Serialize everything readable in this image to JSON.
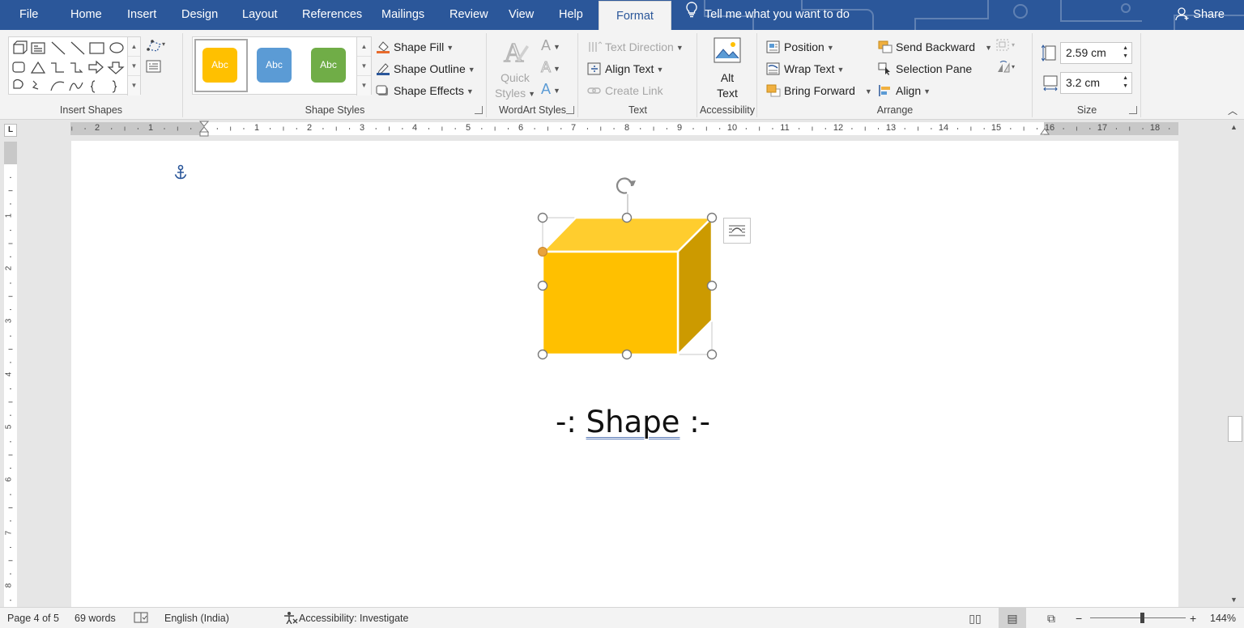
{
  "tabs": [
    "File",
    "Home",
    "Insert",
    "Design",
    "Layout",
    "References",
    "Mailings",
    "Review",
    "View",
    "Help"
  ],
  "active_tab": "Format",
  "tell_me": "Tell me what you want to do",
  "share": "Share",
  "ribbon": {
    "insert_shapes": {
      "label": "Insert Shapes"
    },
    "shape_styles": {
      "label": "Shape Styles",
      "swatches": [
        {
          "text": "Abc",
          "color": "#ffc000"
        },
        {
          "text": "Abc",
          "color": "#5b9bd5"
        },
        {
          "text": "Abc",
          "color": "#70ad47"
        }
      ],
      "fill": "Shape Fill",
      "outline": "Shape Outline",
      "effects": "Shape Effects"
    },
    "wordart": {
      "label": "WordArt Styles",
      "quick_styles_1": "Quick",
      "quick_styles_2": "Styles"
    },
    "text": {
      "label": "Text",
      "direction": "Text Direction",
      "align": "Align Text",
      "link": "Create Link"
    },
    "accessibility": {
      "label": "Accessibility",
      "alt_1": "Alt",
      "alt_2": "Text"
    },
    "arrange": {
      "label": "Arrange",
      "position": "Position",
      "wrap": "Wrap Text",
      "bring_forward": "Bring Forward",
      "send_backward": "Send Backward",
      "selection_pane": "Selection Pane",
      "align": "Align"
    },
    "size": {
      "label": "Size",
      "height": "2.59 cm",
      "width": "3.2 cm"
    }
  },
  "ruler": {
    "h_left": [
      "2",
      "1"
    ],
    "h_right": [
      "1",
      "2",
      "3",
      "4",
      "5",
      "6",
      "7",
      "8",
      "9",
      "10",
      "11",
      "12",
      "13",
      "14",
      "15",
      "16",
      "17",
      "18"
    ],
    "v": [
      "1",
      "2",
      "3",
      "4",
      "5",
      "6",
      "7",
      "8"
    ]
  },
  "document": {
    "caption_pre": "-: ",
    "caption_word": "Shape",
    "caption_post": " :-"
  },
  "shape": {
    "front_color": "#ffc000",
    "top_color": "#ffcd2e",
    "side_color": "#cc9a00"
  },
  "status": {
    "page": "Page 4 of 5",
    "words": "69 words",
    "language": "English (India)",
    "accessibility": "Accessibility: Investigate",
    "zoom": "144%"
  }
}
